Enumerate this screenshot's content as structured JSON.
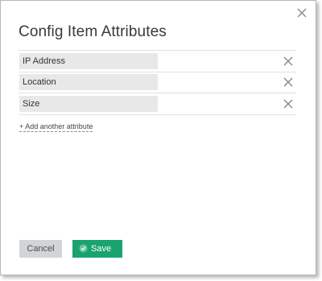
{
  "dialog": {
    "title": "Config Item Attributes",
    "close_icon": "close-icon"
  },
  "attributes": [
    {
      "label": "IP Address",
      "remove_icon": "close-icon"
    },
    {
      "label": "Location",
      "remove_icon": "close-icon"
    },
    {
      "label": "Size",
      "remove_icon": "close-icon"
    }
  ],
  "add_attribute_label": "+ Add another attribute",
  "buttons": {
    "cancel_label": "Cancel",
    "save_label": "Save",
    "save_icon": "check-circle-icon"
  },
  "colors": {
    "save_button": "#1aa36f",
    "cancel_button": "#d1d5d8",
    "field_background": "#e8e8e8",
    "remove_icon": "#7c8a99"
  }
}
